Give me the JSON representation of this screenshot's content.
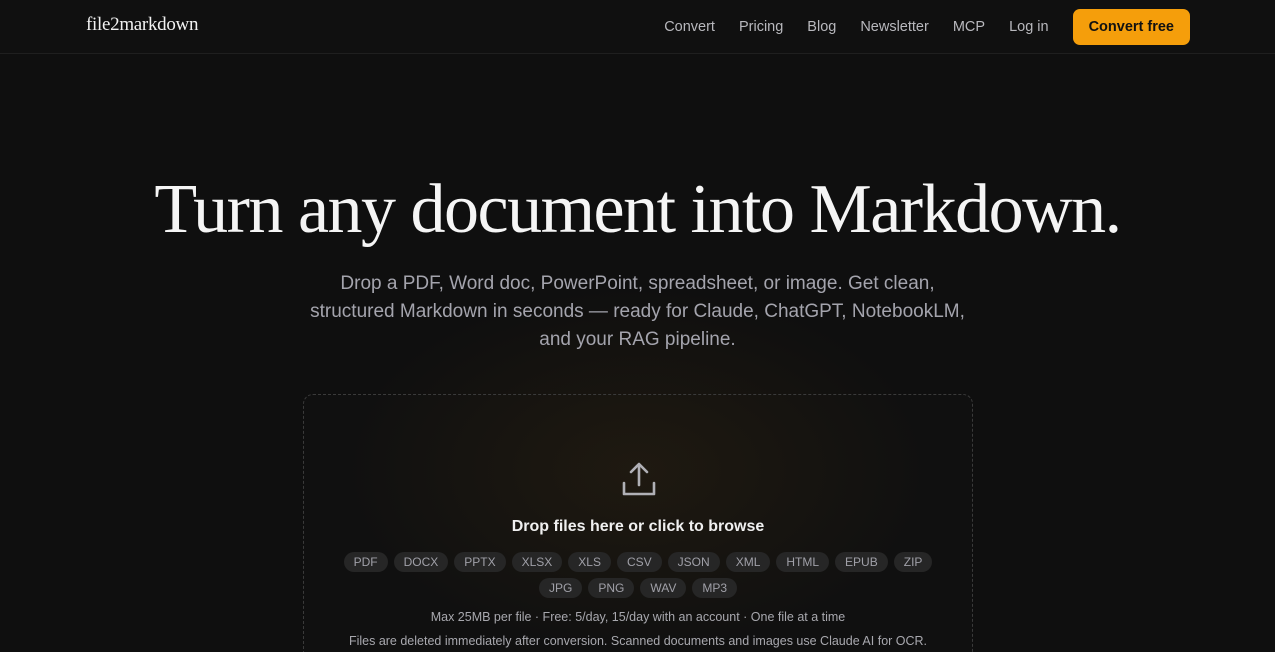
{
  "nav": {
    "brand": "file2markdown",
    "links": [
      "Convert",
      "Pricing",
      "Blog",
      "Newsletter",
      "MCP",
      "Log in"
    ],
    "cta_label": "Convert free"
  },
  "hero": {
    "title": "Turn any document into Markdown.",
    "subtitle": "Drop a PDF, Word doc, PowerPoint, spreadsheet, or image. Get clean, structured Markdown in seconds — ready for Claude, ChatGPT, NotebookLM, and your RAG pipeline."
  },
  "dropzone": {
    "icon": "upload-icon",
    "title": "Drop files here or click to browse",
    "formats_row1": [
      "PDF",
      "DOCX",
      "PPTX",
      "XLSX",
      "XLS",
      "CSV",
      "JSON",
      "XML",
      "HTML",
      "EPUB",
      "ZIP"
    ],
    "formats_row2": [
      "JPG",
      "PNG",
      "WAV",
      "MP3"
    ],
    "limits": "Max 25MB per file · Free: 5/day, 15/day with an account · One file at a time",
    "privacy": "Files are deleted immediately after conversion. Scanned documents and images use Claude AI for OCR."
  },
  "colors": {
    "background": "#0f0f0f",
    "accent": "#f59e0b",
    "chip_bg": "#262626"
  }
}
